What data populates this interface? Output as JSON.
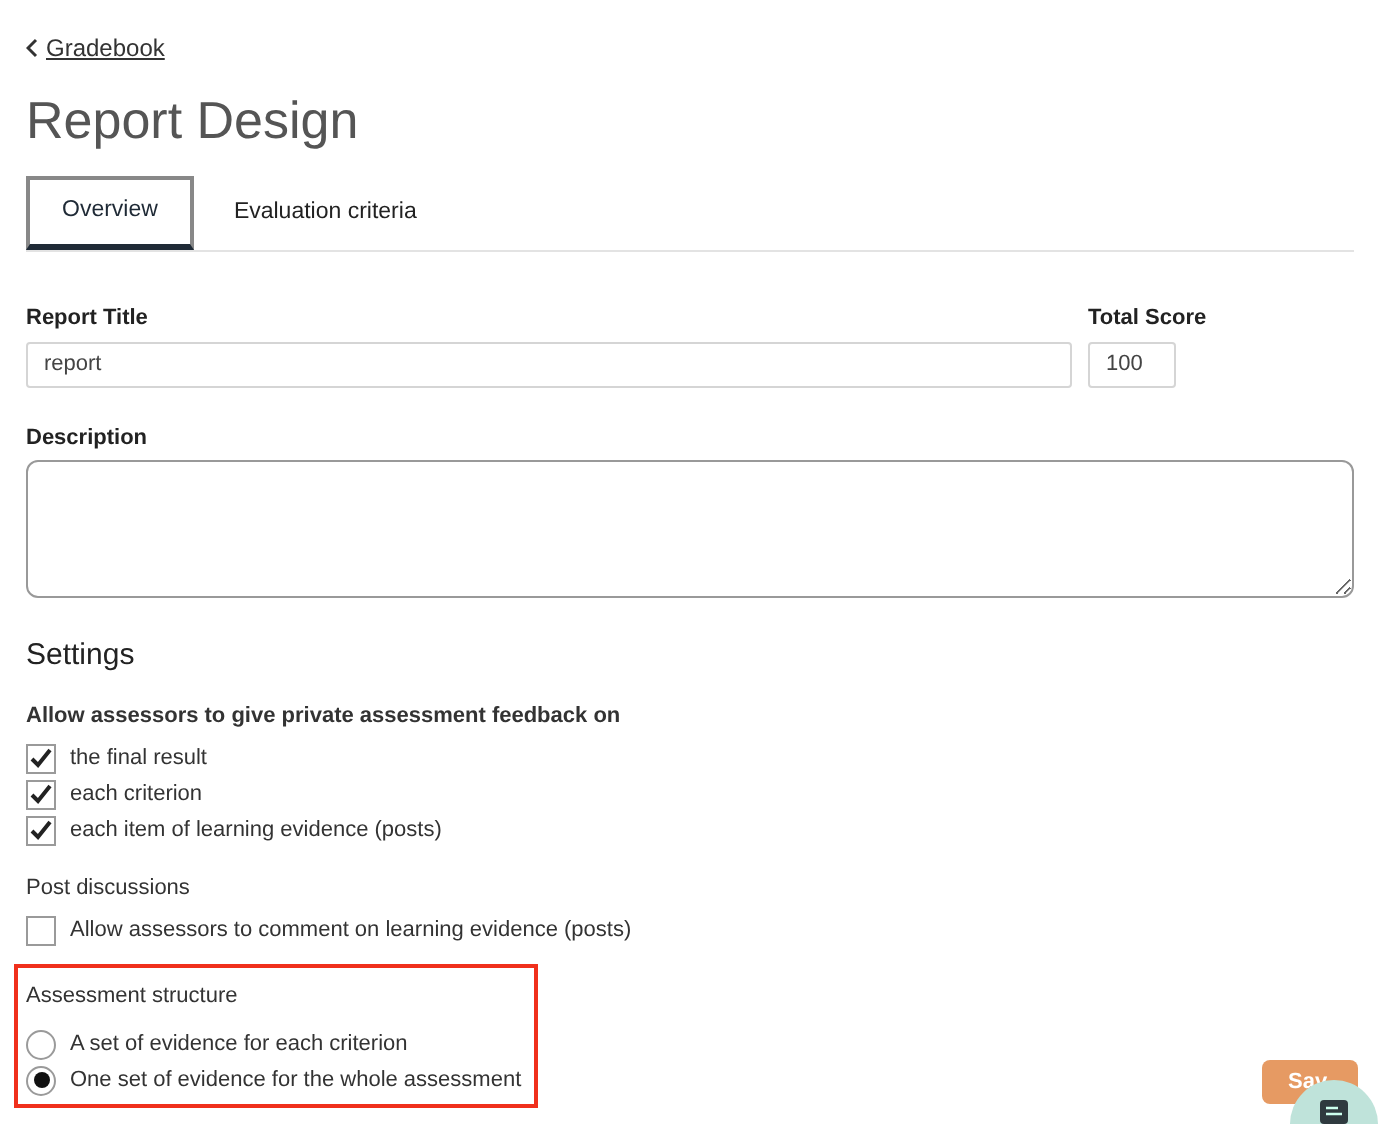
{
  "back_link": {
    "label": "Gradebook"
  },
  "title": "Report Design",
  "tabs": [
    {
      "label": "Overview",
      "selected": true
    },
    {
      "label": "Evaluation criteria",
      "selected": false
    }
  ],
  "report_title": {
    "label": "Report Title",
    "value": "report"
  },
  "total_score": {
    "label": "Total Score",
    "value": "100"
  },
  "description": {
    "label": "Description"
  },
  "settings": {
    "heading": "Settings",
    "feedback": {
      "label": "Allow assessors to give private assessment feedback on",
      "options": [
        {
          "label": "the final result",
          "checked": true
        },
        {
          "label": "each criterion",
          "checked": true
        },
        {
          "label": "each item of learning evidence (posts)",
          "checked": true
        }
      ]
    },
    "discussions": {
      "label": "Post discussions",
      "options": [
        {
          "label": "Allow assessors to comment on learning evidence (posts)",
          "checked": false
        }
      ]
    },
    "structure": {
      "label": "Assessment structure",
      "options": [
        {
          "label": "A set of evidence for each criterion",
          "selected": false
        },
        {
          "label": "One set of evidence for the whole assessment",
          "selected": true
        }
      ]
    }
  },
  "save_button": {
    "label": "Sav"
  }
}
